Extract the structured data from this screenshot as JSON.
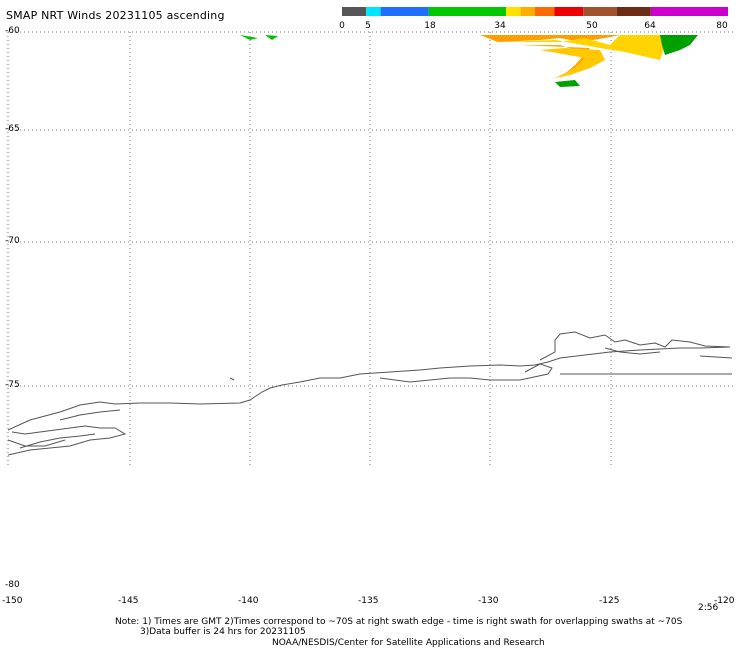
{
  "header": {
    "title": "SMAP NRT Winds 20231105 ascending"
  },
  "colorbar": {
    "labels": [
      "0",
      "5",
      "18",
      "34",
      "50",
      "64",
      "80"
    ],
    "segments": [
      {
        "from": 0,
        "to": 5,
        "color": "#555555"
      },
      {
        "from": 5,
        "to": 8,
        "color": "#00e5ff"
      },
      {
        "from": 8,
        "to": 18,
        "color": "#1f6fff"
      },
      {
        "from": 18,
        "to": 34,
        "color": "#00c800"
      },
      {
        "from": 34,
        "to": 37,
        "color": "#ffe100"
      },
      {
        "from": 37,
        "to": 40,
        "color": "#ffae00"
      },
      {
        "from": 40,
        "to": 44,
        "color": "#ff6a00"
      },
      {
        "from": 44,
        "to": 50,
        "color": "#ee0000"
      },
      {
        "from": 50,
        "to": 57,
        "color": "#a0522d"
      },
      {
        "from": 57,
        "to": 64,
        "color": "#6b2b14"
      },
      {
        "from": 64,
        "to": 80,
        "color": "#cc00cc"
      }
    ]
  },
  "map": {
    "lon_range": [
      -150,
      -120
    ],
    "lat_range": [
      -80,
      -60
    ],
    "lat_labels": [
      "-60",
      "-65",
      "-70",
      "-75",
      "-80"
    ],
    "lon_labels": [
      "-150",
      "-145",
      "-140",
      "-135",
      "-130",
      "-125",
      "-120"
    ],
    "time_label": "2:56"
  },
  "notes": {
    "line1": "Note: 1) Times are GMT 2)Times correspond to ~70S at right swath edge - time is right swath for overlapping swaths at ~70S",
    "line2": "3)Data buffer is 24 hrs for 20231105",
    "line3": "NOAA/NESDIS/Center for Satellite Applications and Research"
  },
  "colors": {
    "wind_orange": "#ff9e00",
    "wind_yellow": "#ffd400",
    "wind_green": "#00b000",
    "coastline": "#555555"
  }
}
